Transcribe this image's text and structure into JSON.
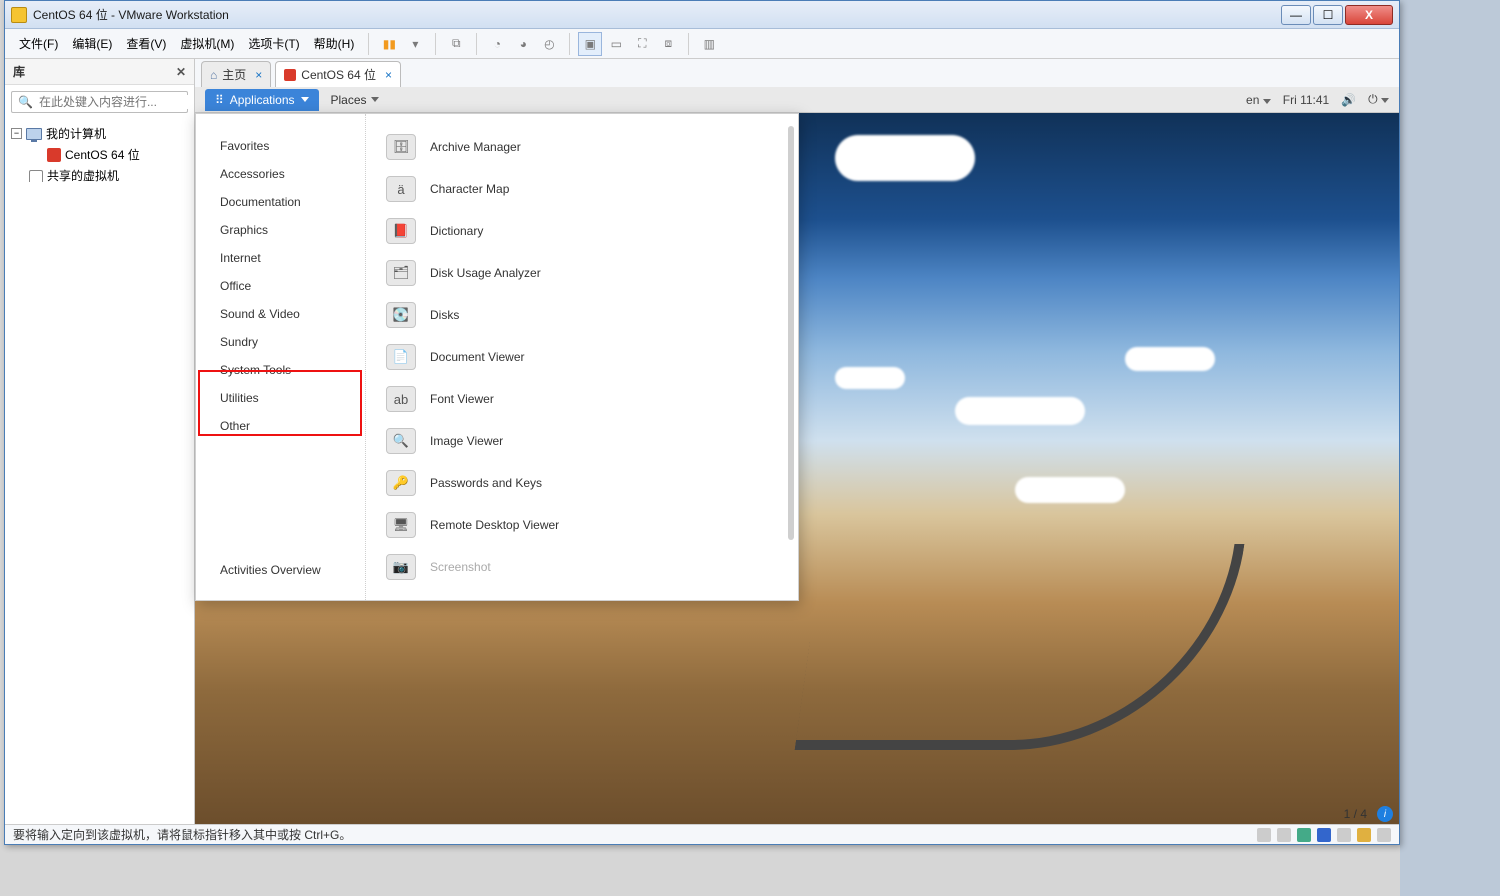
{
  "host": {
    "title": "CentOS 64 位 - VMware Workstation",
    "tabs": [
      "",
      "",
      "",
      "",
      "",
      ""
    ],
    "menubar": {
      "file": "文件(F)",
      "edit": "编辑(E)",
      "view": "查看(V)",
      "vm": "虚拟机(M)",
      "tabs": "选项卡(T)",
      "help": "帮助(H)"
    },
    "sidebar": {
      "title": "库",
      "search_placeholder": "在此处键入内容进行...",
      "root": "我的计算机",
      "vm": "CentOS 64 位",
      "shared": "共享的虚拟机"
    },
    "vmtabs": {
      "home": "主页",
      "vm": "CentOS 64 位"
    },
    "status": "要将输入定向到该虚拟机，请将鼠标指针移入其中或按 Ctrl+G。",
    "page_indicator": "1 / 4",
    "winbtns": {
      "min": "—",
      "max": "☐",
      "close": "X"
    }
  },
  "guest": {
    "topbar": {
      "apps": "Applications",
      "places": "Places",
      "lang": "en",
      "clock": "Fri 11:41"
    },
    "menu": {
      "categories": [
        "Favorites",
        "Accessories",
        "Documentation",
        "Graphics",
        "Internet",
        "Office",
        "Sound & Video",
        "Sundry",
        "System Tools",
        "Utilities",
        "Other"
      ],
      "activities": "Activities Overview",
      "apps": [
        {
          "label": "Archive Manager",
          "icon": "archive"
        },
        {
          "label": "Character Map",
          "icon": "char"
        },
        {
          "label": "Dictionary",
          "icon": "dict"
        },
        {
          "label": "Disk Usage Analyzer",
          "icon": "disk-usage"
        },
        {
          "label": "Disks",
          "icon": "disks"
        },
        {
          "label": "Document Viewer",
          "icon": "docview"
        },
        {
          "label": "Font Viewer",
          "icon": "font"
        },
        {
          "label": "Image Viewer",
          "icon": "imgview"
        },
        {
          "label": "Passwords and Keys",
          "icon": "keys"
        },
        {
          "label": "Remote Desktop Viewer",
          "icon": "rdp"
        },
        {
          "label": "Screenshot",
          "icon": "screenshot",
          "dim": true
        }
      ]
    }
  }
}
